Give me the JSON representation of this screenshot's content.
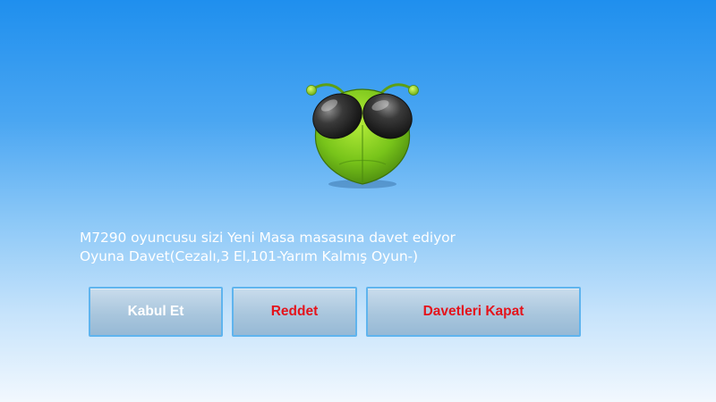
{
  "logo": {
    "icon": "bug-mascot-icon"
  },
  "invite": {
    "line1": "M7290 oyuncusu sizi Yeni Masa masasına davet ediyor",
    "line2": "Oyuna Davet(Cezalı,3 El,101-Yarım Kalmış Oyun-)"
  },
  "buttons": {
    "accept": "Kabul Et",
    "reject": "Reddet",
    "close_invites": "Davetleri Kapat"
  },
  "colors": {
    "accept_text": "#ffffff",
    "reject_text": "#e4141c",
    "close_text": "#e4141c"
  }
}
